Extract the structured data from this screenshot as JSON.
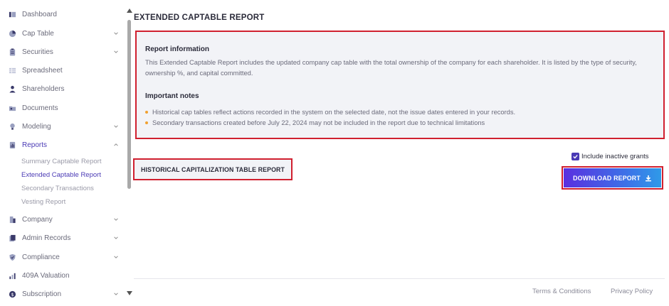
{
  "sidebar": {
    "items": [
      {
        "label": "Dashboard",
        "icon": "dashboard-icon",
        "chevron": false
      },
      {
        "label": "Cap Table",
        "icon": "pie-chart-icon",
        "chevron": true
      },
      {
        "label": "Securities",
        "icon": "clipboard-icon",
        "chevron": true
      },
      {
        "label": "Spreadsheet",
        "icon": "spreadsheet-icon",
        "chevron": false
      },
      {
        "label": "Shareholders",
        "icon": "person-icon",
        "chevron": false
      },
      {
        "label": "Documents",
        "icon": "folder-icon",
        "chevron": false
      },
      {
        "label": "Modeling",
        "icon": "lightbulb-icon",
        "chevron": true
      },
      {
        "label": "Reports",
        "icon": "report-icon",
        "chevron": true,
        "expanded": true
      },
      {
        "label": "Company",
        "icon": "building-icon",
        "chevron": true
      },
      {
        "label": "Admin Records",
        "icon": "records-icon",
        "chevron": true
      },
      {
        "label": "Compliance",
        "icon": "shield-icon",
        "chevron": true
      },
      {
        "label": "409A Valuation",
        "icon": "valuation-icon",
        "chevron": false
      },
      {
        "label": "Subscription",
        "icon": "subscription-icon",
        "chevron": true
      }
    ],
    "reports_sub": [
      {
        "label": "Summary Captable Report"
      },
      {
        "label": "Extended Captable Report",
        "active": true
      },
      {
        "label": "Secondary Transactions"
      },
      {
        "label": "Vesting Report"
      }
    ]
  },
  "main": {
    "title": "EXTENDED CAPTABLE REPORT",
    "info": {
      "heading": "Report information",
      "text": "This Extended Captable Report includes the updated company cap table with the total ownership of the company for each shareholder. It is listed by the type of security, ownership %, and capital committed.",
      "notes_heading": "Important notes",
      "notes": [
        "Historical cap tables reflect actions recorded in the system on the selected date, not the issue dates entered in your records.",
        "Secondary transactions created before July 22, 2024 may not be included in the report due to technical limitations"
      ]
    },
    "historical_button": "HISTORICAL CAPITALIZATION TABLE REPORT",
    "include_inactive_label": "Include inactive grants",
    "include_inactive_checked": true,
    "download_button": "DOWNLOAD REPORT"
  },
  "footer": {
    "terms": "Terms & Conditions",
    "privacy": "Privacy Policy"
  },
  "colors": {
    "accent": "#4a3ab5",
    "highlight_border": "#d0202f",
    "note_dot": "#f0a030"
  }
}
